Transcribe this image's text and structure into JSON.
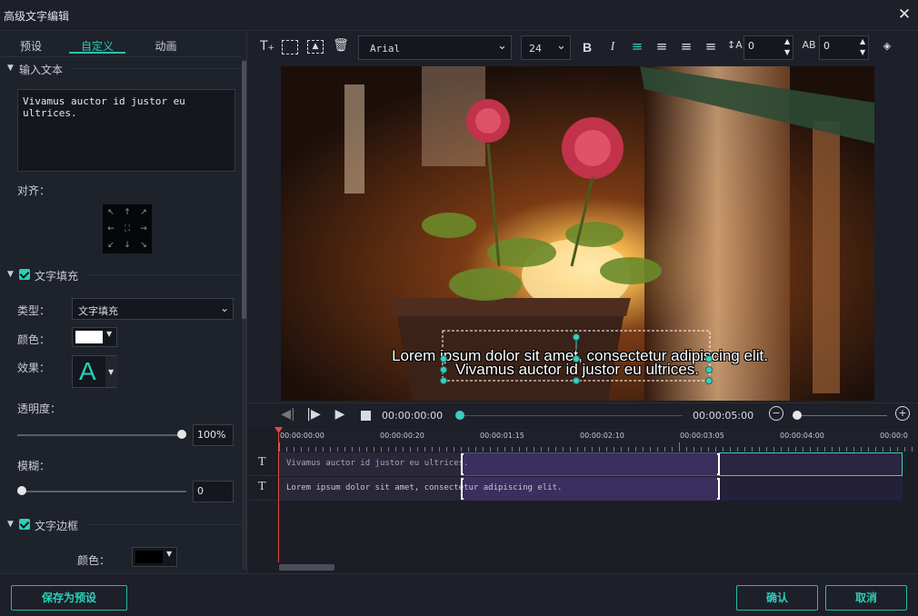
{
  "window": {
    "title": "高级文字编辑",
    "close": "✕"
  },
  "tabs": [
    {
      "label": "预设"
    },
    {
      "label": "自定义"
    },
    {
      "label": "动画"
    }
  ],
  "input_section": {
    "title": "输入文本",
    "text": "Vivamus auctor id justor eu ultrices.",
    "align_label": "对齐："
  },
  "fill_section": {
    "title": "文字填充",
    "type_label": "类型：",
    "type_value": "文字填充",
    "color_label": "颜色：",
    "effect_label": "效果：",
    "effect_glyph": "A",
    "opacity_label": "透明度：",
    "opacity_value": "100%",
    "opacity_level": 1.0,
    "blur_label": "模糊：",
    "blur_value": "0",
    "blur_level": 0.0
  },
  "border_section": {
    "title": "文字边框",
    "color_label": "颜色："
  },
  "toolbar": {
    "font": "Arial",
    "size": "24",
    "bold": "B",
    "italic": "I",
    "spacing_value": "0",
    "kerning_value": "0"
  },
  "preview": {
    "line1": "Lorem ipsum dolor sit amet, consectetur adipiscing elit.",
    "line2": "Vivamus auctor id justor eu ultrices."
  },
  "playback": {
    "current_time": "00:00:00:00",
    "total_time": "00:00:05:00"
  },
  "ruler": {
    "labels": [
      "00:00:00:00",
      "00:00:00:20",
      "00:00:01:15",
      "00:00:02:10",
      "00:00:03:05",
      "00:00:04:00",
      "00:00:0"
    ]
  },
  "tracks": [
    {
      "icon": "T",
      "clip_text": "Vivamus auctor id justor eu ultrices."
    },
    {
      "icon": "T",
      "clip_text": "Lorem ipsum dolor sit amet, consectetur adipiscing elit."
    }
  ],
  "buttons": {
    "save_preset": "保存为预设",
    "ok": "确认",
    "cancel": "取消"
  },
  "colors": {
    "accent": "#2ad0b8",
    "fill_color": "#ffffff",
    "border_color": "#000000",
    "clip_bg": "#3a2f5e"
  }
}
